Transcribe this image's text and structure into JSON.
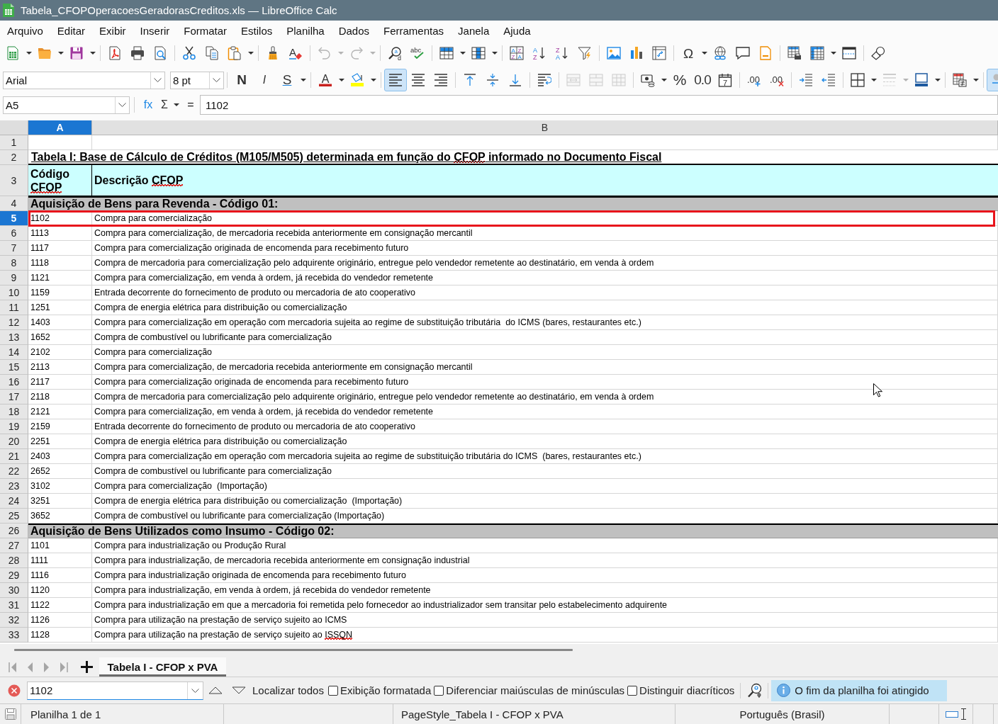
{
  "window": {
    "title": "Tabela_CFOPOperacoesGeradorasCreditos.xls — LibreOffice Calc"
  },
  "menu": [
    "Arquivo",
    "Editar",
    "Exibir",
    "Inserir",
    "Formatar",
    "Estilos",
    "Planilha",
    "Dados",
    "Ferramentas",
    "Janela",
    "Ajuda"
  ],
  "standard_toolbar": [
    [
      {
        "kind": "new",
        "dropdown": true,
        "disabled": false,
        "on": false
      },
      {
        "kind": "open",
        "dropdown": true,
        "disabled": false,
        "on": false
      },
      {
        "kind": "save",
        "dropdown": true,
        "disabled": false,
        "on": false
      }
    ],
    [
      {
        "kind": "export_pdf",
        "dropdown": false,
        "disabled": false,
        "on": false
      },
      {
        "kind": "print",
        "dropdown": false,
        "disabled": false,
        "on": false
      },
      {
        "kind": "print_preview",
        "dropdown": false,
        "disabled": false,
        "on": false
      }
    ],
    [
      {
        "kind": "cut",
        "dropdown": false,
        "disabled": false,
        "on": false
      },
      {
        "kind": "copy",
        "dropdown": false,
        "disabled": false,
        "on": false
      },
      {
        "kind": "paste",
        "dropdown": true,
        "disabled": false,
        "on": false
      }
    ],
    [
      {
        "kind": "clone_formatting",
        "dropdown": false,
        "disabled": false,
        "on": false
      },
      {
        "kind": "clear_formatting",
        "glyphs": [
          "A"
        ],
        "dropdown": false,
        "disabled": false,
        "on": false
      }
    ],
    [
      {
        "kind": "undo",
        "dropdown": true,
        "disabled": true,
        "on": false
      },
      {
        "kind": "redo",
        "dropdown": true,
        "disabled": true,
        "on": false
      }
    ],
    [
      {
        "kind": "find_replace",
        "glyphs": [
          "a",
          "d"
        ],
        "dropdown": false,
        "disabled": false,
        "on": false
      },
      {
        "kind": "spelling",
        "glyphs": [
          "abc"
        ],
        "dropdown": false,
        "disabled": false,
        "on": false
      }
    ],
    [
      {
        "kind": "rows",
        "dropdown": true,
        "disabled": false,
        "on": false
      },
      {
        "kind": "columns",
        "dropdown": true,
        "disabled": false,
        "on": false
      }
    ],
    [
      {
        "kind": "sort",
        "glyphs": [
          "A",
          "Z",
          "Z",
          "A"
        ],
        "dropdown": false,
        "disabled": false,
        "on": false
      },
      {
        "kind": "sort_ascending",
        "glyphs": [
          "A",
          "Z"
        ],
        "dropdown": false,
        "disabled": false,
        "on": false
      },
      {
        "kind": "sort_descending",
        "glyphs": [
          "Z",
          "A"
        ],
        "dropdown": false,
        "disabled": false,
        "on": false
      },
      {
        "kind": "autofilter",
        "dropdown": false,
        "disabled": false,
        "on": false
      }
    ],
    [
      {
        "kind": "image",
        "dropdown": false,
        "disabled": false,
        "on": false
      },
      {
        "kind": "chart",
        "dropdown": false,
        "disabled": false,
        "on": false
      },
      {
        "kind": "pivot_table",
        "dropdown": false,
        "disabled": false,
        "on": false
      }
    ],
    [
      {
        "kind": "special_character",
        "glyphs": [
          "Ω"
        ],
        "dropdown": true,
        "disabled": false,
        "on": false
      },
      {
        "kind": "hyperlink",
        "dropdown": false,
        "disabled": false,
        "on": false
      },
      {
        "kind": "comment",
        "dropdown": false,
        "disabled": false,
        "on": false
      },
      {
        "kind": "header_footer",
        "dropdown": false,
        "disabled": false,
        "on": false
      }
    ],
    [
      {
        "kind": "print_area",
        "dropdown": false,
        "disabled": false,
        "on": false
      },
      {
        "kind": "freeze",
        "dropdown": true,
        "disabled": false,
        "on": false
      },
      {
        "kind": "split_window",
        "dropdown": false,
        "disabled": false,
        "on": false
      }
    ],
    [
      {
        "kind": "shapes",
        "dropdown": false,
        "disabled": false,
        "on": false
      }
    ]
  ],
  "formatting_toolbar": {
    "font_name": "Arial",
    "font_size": "8 pt",
    "groups": [
      [
        {
          "kind": "bold",
          "glyphs": [
            "N"
          ],
          "dropdown": false,
          "disabled": false,
          "on": false
        },
        {
          "kind": "italic",
          "glyphs": [
            "I"
          ],
          "dropdown": false,
          "disabled": false,
          "on": false
        },
        {
          "kind": "underline",
          "glyphs": [
            "S"
          ],
          "dropdown": true,
          "disabled": false,
          "on": false
        }
      ],
      [
        {
          "kind": "font_color",
          "glyphs": [
            "A"
          ],
          "dropdown": true,
          "disabled": false,
          "on": false
        },
        {
          "kind": "highlight",
          "dropdown": true,
          "disabled": false,
          "on": false
        }
      ],
      [
        {
          "kind": "align_left",
          "dropdown": false,
          "disabled": false,
          "on": true
        },
        {
          "kind": "align_center",
          "dropdown": false,
          "disabled": false,
          "on": false
        },
        {
          "kind": "align_right",
          "dropdown": false,
          "disabled": false,
          "on": false
        }
      ],
      [
        {
          "kind": "align_top",
          "dropdown": false,
          "disabled": false,
          "on": false
        },
        {
          "kind": "align_middle",
          "dropdown": false,
          "disabled": false,
          "on": false
        },
        {
          "kind": "align_bottom",
          "dropdown": false,
          "disabled": false,
          "on": false
        }
      ],
      [
        {
          "kind": "wrap",
          "dropdown": false,
          "disabled": false,
          "on": false
        }
      ],
      [
        {
          "kind": "merge_center",
          "dropdown": false,
          "disabled": true,
          "on": false
        },
        {
          "kind": "merge",
          "dropdown": false,
          "disabled": true,
          "on": false
        },
        {
          "kind": "unmerge",
          "dropdown": false,
          "disabled": true,
          "on": false
        }
      ],
      [
        {
          "kind": "currency",
          "dropdown": true,
          "disabled": false,
          "on": false
        },
        {
          "kind": "percent",
          "glyphs": [
            "%"
          ],
          "dropdown": false,
          "disabled": false,
          "on": false
        },
        {
          "kind": "number",
          "glyphs": [
            "0.0"
          ],
          "dropdown": false,
          "disabled": false,
          "on": false
        },
        {
          "kind": "date",
          "glyphs": [
            "7"
          ],
          "dropdown": false,
          "disabled": false,
          "on": false
        }
      ],
      [
        {
          "kind": "add_decimal",
          "glyphs": [
            ".00"
          ],
          "dropdown": false,
          "disabled": false,
          "on": false
        },
        {
          "kind": "delete_decimal",
          "glyphs": [
            ".00"
          ],
          "dropdown": false,
          "disabled": false,
          "on": false
        }
      ],
      [
        {
          "kind": "indent_more",
          "dropdown": false,
          "disabled": false,
          "on": false
        },
        {
          "kind": "indent_less",
          "dropdown": false,
          "disabled": false,
          "on": false
        }
      ],
      [
        {
          "kind": "borders",
          "dropdown": true,
          "disabled": false,
          "on": false
        },
        {
          "kind": "border_style",
          "dropdown": true,
          "disabled": true,
          "on": false
        },
        {
          "kind": "border_color",
          "dropdown": true,
          "disabled": false,
          "on": false
        }
      ],
      [
        {
          "kind": "conditional",
          "dropdown": true,
          "disabled": false,
          "on": false
        }
      ],
      [
        {
          "kind": "partial",
          "dropdown": false,
          "disabled": false,
          "on": true
        }
      ]
    ]
  },
  "formula_bar": {
    "name_box": "A5",
    "function_wizard": "fx",
    "sum": "Σ",
    "equals": "=",
    "content": "1102"
  },
  "sheet": {
    "columns": [
      {
        "label": "A",
        "selected": true
      },
      {
        "label": "B",
        "selected": false
      }
    ],
    "rows": [
      {
        "number": "1",
        "kind": "blank",
        "selected": false,
        "highlighted": false
      },
      {
        "number": "2",
        "kind": "title",
        "selected": false,
        "highlighted": false,
        "text": [
          {
            "text": "Tabela I: Base de Cálculo de Créditos (M105/M505) determinada em função do ",
            "misspelled": false
          },
          {
            "text": "CFOP",
            "misspelled": true
          },
          {
            "text": " informado no Documento Fiscal",
            "misspelled": false
          }
        ]
      },
      {
        "number": "3",
        "kind": "header",
        "selected": false,
        "highlighted": false,
        "code": [
          {
            "text": "Código ",
            "misspelled": false
          },
          {
            "text": "CFOP",
            "misspelled": true
          }
        ],
        "description": [
          {
            "text": "Descrição ",
            "misspelled": false
          },
          {
            "text": "CFOP",
            "misspelled": true
          }
        ]
      },
      {
        "number": "4",
        "kind": "section",
        "selected": false,
        "highlighted": false,
        "text": "Aquisição de Bens para Revenda - Código 01:"
      },
      {
        "number": "5",
        "kind": "data",
        "selected": true,
        "highlighted": true,
        "code": "1102",
        "description": "Compra para comercialização"
      },
      {
        "number": "6",
        "kind": "data",
        "selected": false,
        "highlighted": false,
        "code": "1113",
        "description": "Compra para comercialização, de mercadoria recebida anteriormente em consignação mercantil"
      },
      {
        "number": "7",
        "kind": "data",
        "selected": false,
        "highlighted": false,
        "code": "1117",
        "description": "Compra para comercialização originada de encomenda para recebimento futuro"
      },
      {
        "number": "8",
        "kind": "data",
        "selected": false,
        "highlighted": false,
        "code": "1118",
        "description": "Compra de mercadoria para comercialização pelo adquirente originário, entregue pelo vendedor remetente ao destinatário, em venda à ordem"
      },
      {
        "number": "9",
        "kind": "data",
        "selected": false,
        "highlighted": false,
        "code": "1121",
        "description": "Compra para comercialização, em venda à ordem, já recebida do vendedor remetente"
      },
      {
        "number": "10",
        "kind": "data",
        "selected": false,
        "highlighted": false,
        "code": "1159",
        "description": "Entrada decorrente do fornecimento de produto ou mercadoria de ato cooperativo"
      },
      {
        "number": "11",
        "kind": "data",
        "selected": false,
        "highlighted": false,
        "code": "1251",
        "description": "Compra de energia elétrica para distribuição ou comercialização"
      },
      {
        "number": "12",
        "kind": "data",
        "selected": false,
        "highlighted": false,
        "code": "1403",
        "description": "Compra para comercialização em operação com mercadoria sujeita ao regime de substituição tributária  do ICMS (bares, restaurantes etc.)"
      },
      {
        "number": "13",
        "kind": "data",
        "selected": false,
        "highlighted": false,
        "code": "1652",
        "description": "Compra de combustível ou lubrificante para comercialização"
      },
      {
        "number": "14",
        "kind": "data",
        "selected": false,
        "highlighted": false,
        "code": "2102",
        "description": "Compra para comercialização"
      },
      {
        "number": "15",
        "kind": "data",
        "selected": false,
        "highlighted": false,
        "code": "2113",
        "description": "Compra para comercialização, de mercadoria recebida anteriormente em consignação mercantil"
      },
      {
        "number": "16",
        "kind": "data",
        "selected": false,
        "highlighted": false,
        "code": "2117",
        "description": "Compra para comercialização originada de encomenda para recebimento futuro"
      },
      {
        "number": "17",
        "kind": "data",
        "selected": false,
        "highlighted": false,
        "code": "2118",
        "description": "Compra de mercadoria para comercialização pelo adquirente originário, entregue pelo vendedor remetente ao destinatário, em venda à ordem"
      },
      {
        "number": "18",
        "kind": "data",
        "selected": false,
        "highlighted": false,
        "code": "2121",
        "description": "Compra para comercialização, em venda à ordem, já recebida do vendedor remetente"
      },
      {
        "number": "19",
        "kind": "data",
        "selected": false,
        "highlighted": false,
        "code": "2159",
        "description": "Entrada decorrente do fornecimento de produto ou mercadoria de ato cooperativo"
      },
      {
        "number": "20",
        "kind": "data",
        "selected": false,
        "highlighted": false,
        "code": "2251",
        "description": "Compra de energia elétrica para distribuição ou comercialização"
      },
      {
        "number": "21",
        "kind": "data",
        "selected": false,
        "highlighted": false,
        "code": "2403",
        "description": "Compra para comercialização em operação com mercadoria sujeita ao regime de substituição tributária do ICMS  (bares, restaurantes etc.)"
      },
      {
        "number": "22",
        "kind": "data",
        "selected": false,
        "highlighted": false,
        "code": "2652",
        "description": "Compra de combustível ou lubrificante para comercialização"
      },
      {
        "number": "23",
        "kind": "data",
        "selected": false,
        "highlighted": false,
        "code": "3102",
        "description": "Compra para comercialização  (Importação)"
      },
      {
        "number": "24",
        "kind": "data",
        "selected": false,
        "highlighted": false,
        "code": "3251",
        "description": "Compra de energia elétrica para distribuição ou comercialização  (Importação)"
      },
      {
        "number": "25",
        "kind": "data",
        "selected": false,
        "highlighted": false,
        "code": "3652",
        "description": "Compra de combustível ou lubrificante para comercialização (Importação)"
      },
      {
        "number": "26",
        "kind": "section",
        "selected": false,
        "highlighted": false,
        "text": "Aquisição de Bens Utilizados como Insumo - Código 02:"
      },
      {
        "number": "27",
        "kind": "data",
        "selected": false,
        "highlighted": false,
        "code": "1101",
        "description": "Compra para industrialização ou Produção Rural"
      },
      {
        "number": "28",
        "kind": "data",
        "selected": false,
        "highlighted": false,
        "code": "1111",
        "description": "Compra para industrialização, de mercadoria recebida anteriormente em consignação industrial"
      },
      {
        "number": "29",
        "kind": "data",
        "selected": false,
        "highlighted": false,
        "code": "1116",
        "description": "Compra para industrialização originada de encomenda para recebimento futuro"
      },
      {
        "number": "30",
        "kind": "data",
        "selected": false,
        "highlighted": false,
        "code": "1120",
        "description": "Compra para industrialização, em venda à ordem, já recebida do vendedor remetente"
      },
      {
        "number": "31",
        "kind": "data",
        "selected": false,
        "highlighted": false,
        "code": "1122",
        "description": "Compra para industrialização em que a mercadoria foi remetida pelo fornecedor ao industrializador sem transitar pelo estabelecimento adquirente"
      },
      {
        "number": "32",
        "kind": "data",
        "selected": false,
        "highlighted": false,
        "code": "1126",
        "description": "Compra para utilização na prestação de serviço sujeito ao ICMS"
      },
      {
        "number": "33",
        "kind": "data",
        "selected": false,
        "highlighted": false,
        "code": "1128",
        "description": [
          {
            "text": "Compra para utilização na prestação de serviço sujeito ao ",
            "misspelled": false
          },
          {
            "text": "ISSQN",
            "misspelled": true
          }
        ]
      }
    ]
  },
  "sheet_tabs": [
    {
      "label": "Tabela I - CFOP x PVA",
      "selected": true
    }
  ],
  "find_bar": {
    "query": "1102",
    "find_all": "Localizar todos",
    "options": [
      {
        "label": "Exibição formatada",
        "checked": false
      },
      {
        "label": "Diferenciar maiúsculas de minúsculas",
        "checked": false
      },
      {
        "label": "Distinguir diacríticos",
        "checked": false
      }
    ],
    "message": "O fim da planilha foi atingido"
  },
  "status_bar": {
    "sheet_position": "Planilha 1 de 1",
    "page_style": "PageStyle_Tabela I - CFOP x PVA",
    "language": "Português (Brasil)"
  }
}
